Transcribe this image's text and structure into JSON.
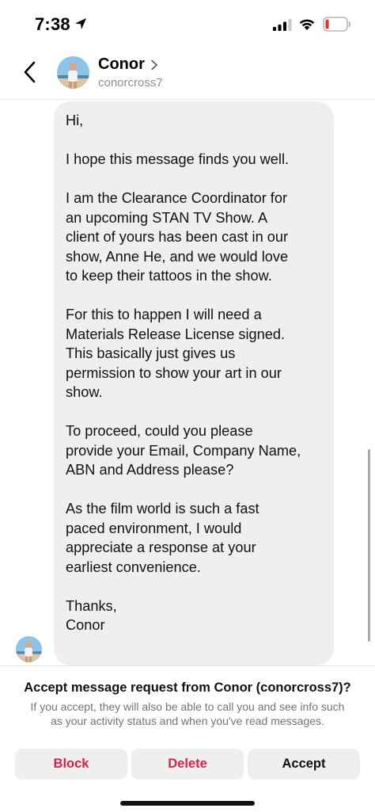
{
  "status_bar": {
    "time": "7:38",
    "icons": [
      "location-arrow-icon",
      "cell-signal-icon",
      "wifi-icon",
      "battery-low-icon"
    ],
    "battery_color": "#e5323a"
  },
  "header": {
    "back_icon": "chevron-left-icon",
    "name": "Conor",
    "name_chevron_icon": "chevron-right-icon",
    "handle": "conorcross7"
  },
  "message": {
    "paragraphs": [
      "Hi,",
      "I hope this message finds you well.",
      "I am the Clearance Coordinator for\nan upcoming STAN TV Show. A\nclient of yours has been cast in our\nshow, Anne He, and we would love\nto keep their tattoos in the show.",
      "For this to happen I will need a\nMaterials Release License signed.\nThis basically just gives us\npermission to show your art in our\nshow.",
      "To proceed, could you please\nprovide your Email, Company Name,\nABN and Address please?",
      "As the film world is such a fast\npaced environment, I would\nappreciate a response at your\nearliest convenience.",
      "Thanks,\nConor"
    ]
  },
  "request": {
    "title": "Accept message request from Conor (conorcross7)?",
    "description": "If you accept, they will also be able to call you and see info such as your activity status and when you've read messages.",
    "buttons": {
      "block": "Block",
      "delete": "Delete",
      "accept": "Accept"
    },
    "destructive_color": "#d8214b"
  }
}
